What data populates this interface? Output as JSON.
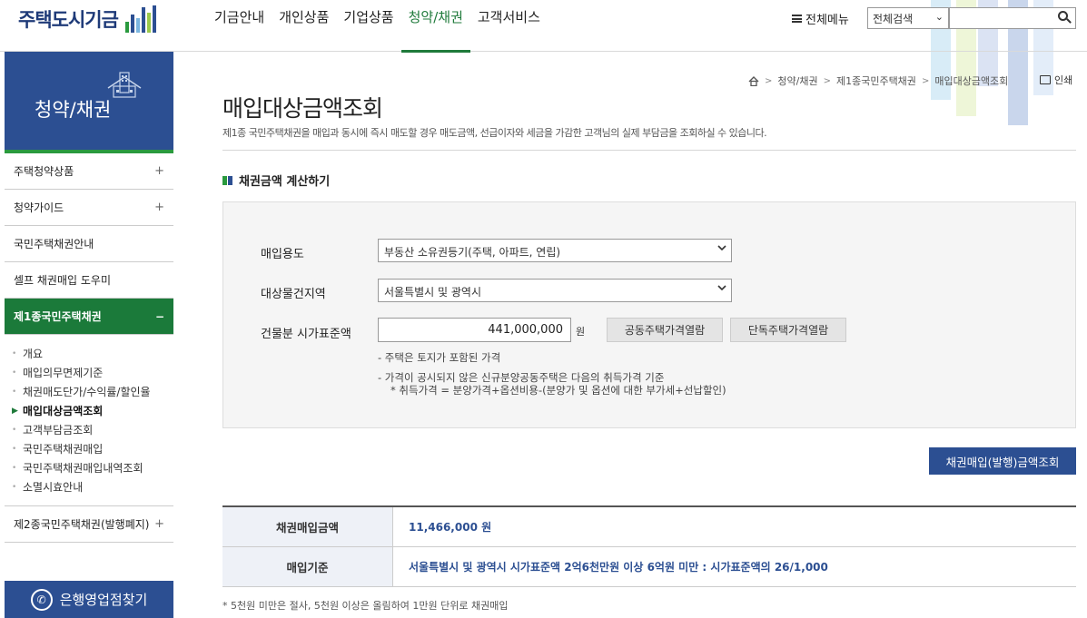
{
  "header": {
    "logo_text": "주택도시기금",
    "nav": [
      {
        "label": "기금안내",
        "active": false
      },
      {
        "label": "개인상품",
        "active": false
      },
      {
        "label": "기업상품",
        "active": false
      },
      {
        "label": "청약/채권",
        "active": true
      },
      {
        "label": "고객서비스",
        "active": false
      }
    ],
    "all_menu": "전체메뉴",
    "search_scope": "전체검색",
    "search_value": ""
  },
  "sidebar": {
    "title": "청약/채권",
    "items": [
      {
        "label": "주택청약상품",
        "toggle": "+"
      },
      {
        "label": "청약가이드",
        "toggle": "+"
      },
      {
        "label": "국민주택채권안내",
        "toggle": ""
      },
      {
        "label": "셀프 채권매입 도우미",
        "toggle": ""
      },
      {
        "label": "제1종국민주택채권",
        "toggle": "−"
      }
    ],
    "sub_items": [
      {
        "label": "개요",
        "active": false
      },
      {
        "label": "매입의무면제기준",
        "active": false
      },
      {
        "label": "채권매도단가/수익률/할인율",
        "active": false
      },
      {
        "label": "매입대상금액조회",
        "active": true
      },
      {
        "label": "고객부담금조회",
        "active": false
      },
      {
        "label": "국민주택채권매입",
        "active": false
      },
      {
        "label": "국민주택채권매입내역조회",
        "active": false
      },
      {
        "label": "소멸시효안내",
        "active": false
      }
    ],
    "last_item": {
      "label": "제2종국민주택채권(발행폐지)",
      "toggle": "+"
    },
    "branch_button": "은행영업점찾기"
  },
  "breadcrumb": [
    "청약/채권",
    "제1종국민주택채권",
    "매입대상금액조회"
  ],
  "print_label": "인쇄",
  "page": {
    "title": "매입대상금액조회",
    "description": "제1종 국민주택채권을 매입과 동시에 즉시 매도할 경우 매도금액, 선급이자와 세금을 가감한 고객님의 실제 부담금을 조회하실 수 있습니다."
  },
  "calc": {
    "section_title": "채권금액 계산하기",
    "purpose_label": "매입용도",
    "purpose_value": "부동산 소유권등기(주택, 아파트, 연립)",
    "region_label": "대상물건지역",
    "region_value": "서울특별시 및 광역시",
    "price_label": "건물분 시가표준액",
    "price_value": "441,000,000",
    "unit": "원",
    "btn_apartment": "공동주택가격열람",
    "btn_house": "단독주택가격열람",
    "note1": "- 주택은 토지가 포함된 가격",
    "note2": "- 가격이 공시되지 않은 신규분양공동주택은 다음의 취득가격 기준",
    "note3": "* 취득가격 = 분양가격+옵션비용-(분양가 및 옵션에 대한 부가세+선납할인)"
  },
  "query_button": "채권매입(발행)금액조회",
  "result": {
    "amount_label": "채권매입금액",
    "amount_value": "11,466,000 원",
    "basis_label": "매입기준",
    "basis_value": "서울특별시 및 광역시 시가표준액 2억6천만원 이상 6억원 미만 : 시가표준액의 26/1,000"
  },
  "footnote": "* 5천원 미만은 절사, 5천원 이상은 올림하여 1만원 단위로 채권매입"
}
